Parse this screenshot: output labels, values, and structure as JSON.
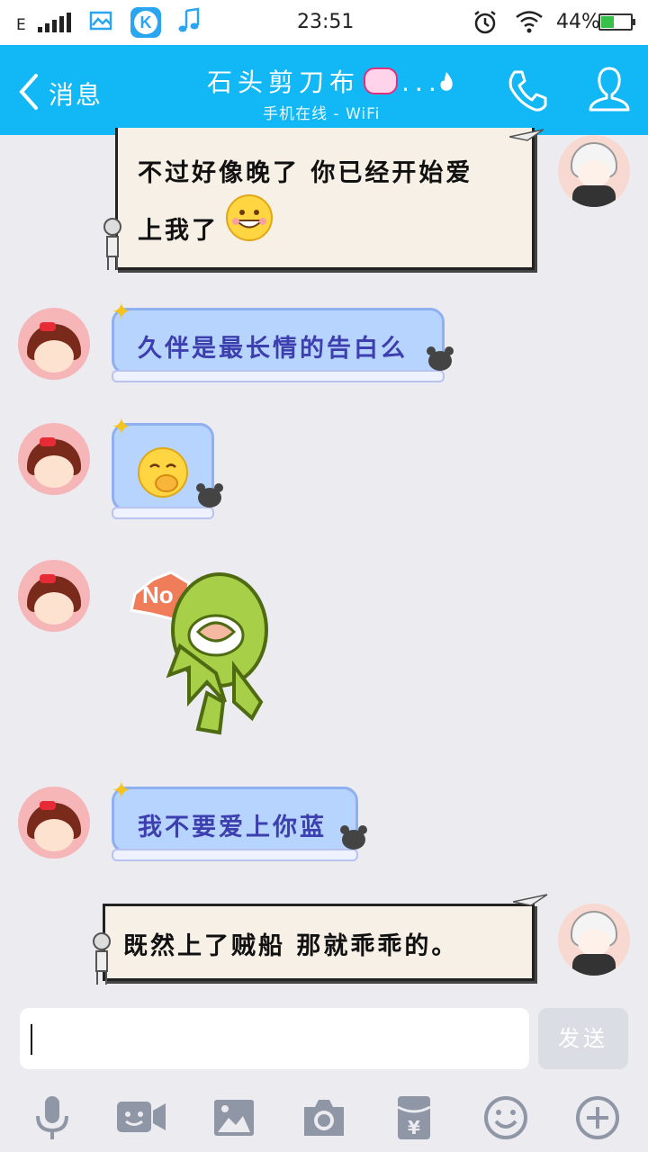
{
  "status_bar": {
    "network": "E",
    "time": "23:51",
    "battery_percent": "44%",
    "battery_level": 0.44,
    "icons": [
      "signal-icon",
      "gallery-icon",
      "kugou-icon",
      "music-icon",
      "alarm-icon",
      "wifi-icon",
      "battery-icon"
    ],
    "kugou_letter": "K"
  },
  "header": {
    "back_label": "消息",
    "title": "石头剪刀布",
    "title_suffix": "...",
    "subtitle": "手机在线 - WiFi",
    "accent": "#12b7f5"
  },
  "messages": [
    {
      "side": "right",
      "style": "paper",
      "lines": [
        "不过好像晚了    你已经开始爱",
        "上我了"
      ],
      "emoji": "grin-emoji"
    },
    {
      "side": "left",
      "style": "bubble",
      "text": "久伴是最长情的告白么"
    },
    {
      "side": "left",
      "style": "bubble",
      "emoji": "giggle-emoji"
    },
    {
      "side": "left",
      "style": "sticker",
      "sticker_text": "No"
    },
    {
      "side": "left",
      "style": "bubble",
      "text": "我不要爱上你蓝"
    },
    {
      "side": "right",
      "style": "paper",
      "text": "既然上了贼船     那就乖乖的。"
    }
  ],
  "composer": {
    "value": "",
    "send_label": "发送"
  },
  "toolbar": {
    "tools": [
      "microphone-icon",
      "video-icon",
      "image-icon",
      "camera-icon",
      "red-packet-icon",
      "emoji-icon",
      "plus-icon"
    ],
    "red_packet_symbol": "¥"
  }
}
